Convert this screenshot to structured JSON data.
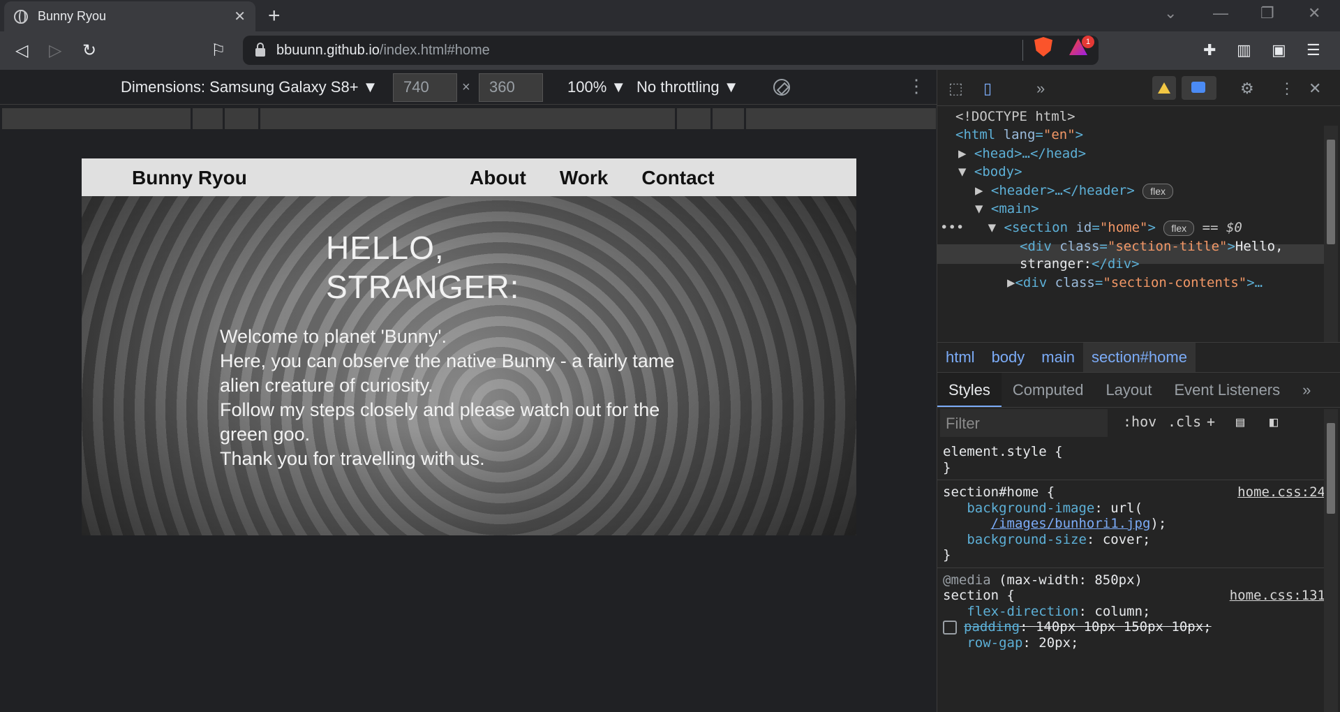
{
  "browser": {
    "tab_title": "Bunny Ryou",
    "tab_close": "✕",
    "new_tab": "+",
    "url_host": "bbuunn.github.io",
    "url_path": "/index.html#home",
    "badge_count": "1"
  },
  "device_toolbar": {
    "dimensions_label": "Dimensions: Samsung Galaxy S8+ ▼",
    "width": "740",
    "height": "360",
    "times": "×",
    "zoom": "100% ▼",
    "throttling": "No throttling ▼"
  },
  "site": {
    "logo": "Bunny Ryou",
    "nav": [
      "About",
      "Work",
      "Contact"
    ],
    "hello_line1": "HELLO,",
    "hello_line2": "STRANGER:",
    "welcome_lines": [
      "Welcome to planet 'Bunny'.",
      "Here, you can observe the native Bunny - a fairly tame alien creature of curiosity.",
      "Follow my steps closely and please watch out for the green goo.",
      "Thank you for travelling with us."
    ]
  },
  "devtools": {
    "dom": {
      "doctype": "<!DOCTYPE html>",
      "html_open": "<html",
      "lang_attr": "lang",
      "lang_val": "\"en\"",
      "head": "<head>…</head>",
      "body": "<body>",
      "header": "<header>…</header>",
      "main": "<main>",
      "section_open": "<section",
      "section_id_attr": "id",
      "section_id_val": "\"home\"",
      "selected_marker": "== $0",
      "div_open": "<div",
      "class_attr": "class",
      "title_class_val": "\"section-title\"",
      "title_text": "Hello,",
      "title_text2": "stranger:",
      "div_close": "</div>",
      "contents_class_val": "\"section-contents\"",
      "ellipsis": ">…",
      "flex_badge": "flex"
    },
    "breadcrumbs": [
      "html",
      "body",
      "main",
      "section#home"
    ],
    "style_tabs": [
      "Styles",
      "Computed",
      "Layout",
      "Event Listeners"
    ],
    "filter_placeholder": "Filter",
    "hov": ":hov",
    "cls": ".cls",
    "rules": {
      "element_style": "element.style {",
      "close_brace": "}",
      "home_selector": "section#home {",
      "home_source": "home.css:24",
      "bg_image_prop": "background-image",
      "bg_image_val": "url(",
      "bg_image_url": "/images/bunhori1.jpg",
      "bg_image_end": ");",
      "bg_size_prop": "background-size",
      "bg_size_val": "cover;",
      "media_query": "@media",
      "media_cond": "(max-width: 850px)",
      "section_selector": "section {",
      "section_source": "home.css:131",
      "flexdir_prop": "flex-direction",
      "flexdir_val": "column;",
      "padding_prop": "padding",
      "padding_val": "140px 10px 150px 10px;",
      "rowgap_prop": "row-gap",
      "rowgap_val": "20px;"
    }
  }
}
